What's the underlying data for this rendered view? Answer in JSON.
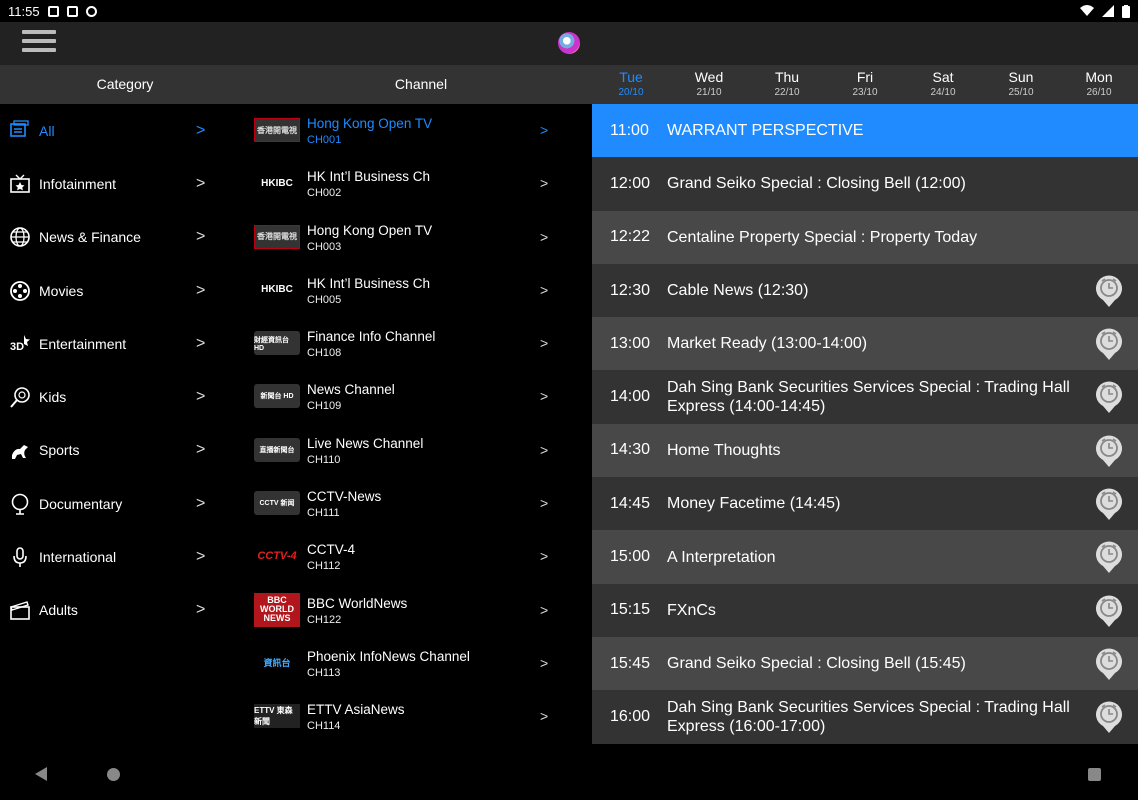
{
  "status_bar": {
    "time": "11:55"
  },
  "header": {
    "category_label": "Category",
    "channel_label": "Channel"
  },
  "days": [
    {
      "name": "Tue",
      "date": "20/10",
      "active": true
    },
    {
      "name": "Wed",
      "date": "21/10"
    },
    {
      "name": "Thu",
      "date": "22/10"
    },
    {
      "name": "Fri",
      "date": "23/10"
    },
    {
      "name": "Sat",
      "date": "24/10"
    },
    {
      "name": "Sun",
      "date": "25/10"
    },
    {
      "name": "Mon",
      "date": "26/10"
    }
  ],
  "categories": [
    {
      "label": "All",
      "icon": "all-channels-icon",
      "active": true
    },
    {
      "label": "Infotainment",
      "icon": "infotainment-icon"
    },
    {
      "label": "News & Finance",
      "icon": "globe-icon"
    },
    {
      "label": "Movies",
      "icon": "film-reel-icon"
    },
    {
      "label": "Entertainment",
      "icon": "entertainment-icon"
    },
    {
      "label": "Kids",
      "icon": "lollipop-icon"
    },
    {
      "label": "Sports",
      "icon": "horse-icon"
    },
    {
      "label": "Documentary",
      "icon": "documentary-globe-icon"
    },
    {
      "label": "International",
      "icon": "microphone-icon"
    },
    {
      "label": "Adults",
      "icon": "clapperboard-icon"
    }
  ],
  "channels": [
    {
      "name": "Hong Kong Open TV",
      "number": "CH001",
      "logo": "香港開電視",
      "active": true
    },
    {
      "name": "HK Int’l Business Ch",
      "number": "CH002",
      "logo": "HKIBC"
    },
    {
      "name": "Hong Kong Open TV",
      "number": "CH003",
      "logo": "香港開電視"
    },
    {
      "name": "HK Int’l Business Ch",
      "number": "CH005",
      "logo": "HKIBC"
    },
    {
      "name": "Finance Info Channel",
      "number": "CH108",
      "logo": "財經資訊台 HD"
    },
    {
      "name": "News Channel",
      "number": "CH109",
      "logo": "新聞台 HD"
    },
    {
      "name": "Live News Channel",
      "number": "CH110",
      "logo": "直播新聞台"
    },
    {
      "name": "CCTV-News",
      "number": "CH111",
      "logo": "CCTV 新闻"
    },
    {
      "name": "CCTV-4",
      "number": "CH112",
      "logo": "CCTV-4"
    },
    {
      "name": "BBC WorldNews",
      "number": "CH122",
      "logo": "BBC WORLD NEWS"
    },
    {
      "name": "Phoenix  InfoNews Channel",
      "number": "CH113",
      "logo": "資訊台"
    },
    {
      "name": "ETTV AsiaNews",
      "number": "CH114",
      "logo": "ETTV 東森新聞"
    }
  ],
  "programs": [
    {
      "time": "11:00",
      "title": "WARRANT PERSPECTIVE",
      "active": true,
      "alarm": false
    },
    {
      "time": "12:00",
      "title": "Grand Seiko Special : Closing Bell (12:00)",
      "alarm": false
    },
    {
      "time": "12:22",
      "title": "Centaline Property Special : Property Today",
      "alarm": false
    },
    {
      "time": "12:30",
      "title": "Cable News (12:30)",
      "alarm": true
    },
    {
      "time": "13:00",
      "title": "Market Ready (13:00-14:00)",
      "alarm": true
    },
    {
      "time": "14:00",
      "title": "Dah Sing Bank Securities Services Special : Trading Hall Express (14:00-14:45)",
      "alarm": true
    },
    {
      "time": "14:30",
      "title": "Home Thoughts",
      "alarm": true
    },
    {
      "time": "14:45",
      "title": "Money Facetime (14:45)",
      "alarm": true
    },
    {
      "time": "15:00",
      "title": "A Interpretation",
      "alarm": true
    },
    {
      "time": "15:15",
      "title": "FXnCs",
      "alarm": true
    },
    {
      "time": "15:45",
      "title": "Grand Seiko Special : Closing Bell (15:45)",
      "alarm": true
    },
    {
      "time": "16:00",
      "title": "Dah Sing Bank Securities Services Special : Trading Hall Express (16:00-17:00)",
      "alarm": true
    }
  ],
  "chevron": ">",
  "colors": {
    "accent": "#1f8bff",
    "row_dark": "#333333",
    "row_light": "#484848"
  }
}
